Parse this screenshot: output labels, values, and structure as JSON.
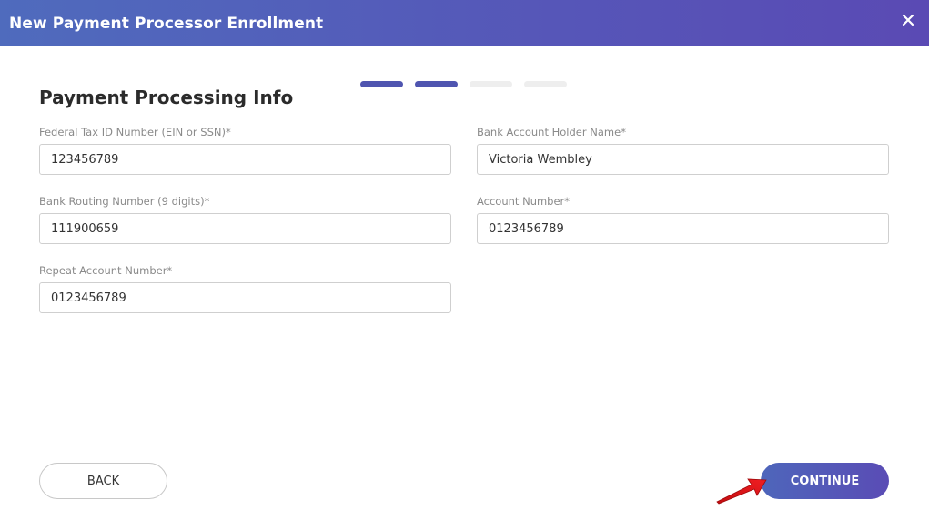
{
  "header": {
    "title": "New Payment Processor Enrollment",
    "close_icon": "close-icon"
  },
  "progress": {
    "total_steps": 4,
    "active_steps": 2
  },
  "section": {
    "title": "Payment Processing Info"
  },
  "form": {
    "fields": [
      {
        "label": "Federal Tax ID Number (EIN or SSN)*",
        "value": "123456789"
      },
      {
        "label": "Bank Account Holder Name*",
        "value": "Victoria Wembley"
      },
      {
        "label": "Bank Routing Number (9 digits)*",
        "value": "111900659"
      },
      {
        "label": "Account Number*",
        "value": "0123456789"
      },
      {
        "label": "Repeat Account Number*",
        "value": "0123456789"
      }
    ]
  },
  "buttons": {
    "back_label": "BACK",
    "continue_label": "CONTINUE"
  },
  "colors": {
    "accent": "#5055b3",
    "annotation_arrow": "#e8161a"
  }
}
